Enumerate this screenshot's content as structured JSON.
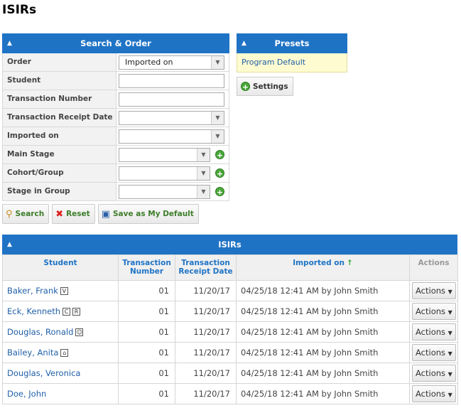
{
  "page_title": "ISIRs",
  "search_panel": {
    "title": "Search & Order",
    "rows": [
      {
        "label": "Order",
        "value": "Imported on"
      },
      {
        "label": "Student"
      },
      {
        "label": "Transaction Number"
      },
      {
        "label": "Transaction Receipt Date"
      },
      {
        "label": "Imported on"
      },
      {
        "label": "Main Stage"
      },
      {
        "label": "Cohort/Group"
      },
      {
        "label": "Stage in Group"
      }
    ],
    "buttons": {
      "search": "Search",
      "reset": "Reset",
      "save_default": "Save as My Default"
    }
  },
  "presets": {
    "title": "Presets",
    "item": "Program Default",
    "settings": "Settings"
  },
  "isirs": {
    "title": "ISIRs",
    "columns": {
      "student": "Student",
      "transaction_number": "Transaction Number",
      "receipt_date": "Transaction Receipt Date",
      "imported_on": "Imported on",
      "actions": "Actions"
    },
    "rows": [
      {
        "student": "Baker, Frank",
        "badges": [
          "V"
        ],
        "txn": "01",
        "date": "11/20/17",
        "imported": "04/25/18 12:41 AM by John Smith",
        "action": "Actions"
      },
      {
        "student": "Eck, Kenneth",
        "badges": [
          "C",
          "R"
        ],
        "txn": "01",
        "date": "11/20/17",
        "imported": "04/25/18 12:41 AM by John Smith",
        "action": "Actions"
      },
      {
        "student": "Douglas, Ronald",
        "badges": [
          "☺"
        ],
        "txn": "01",
        "date": "11/20/17",
        "imported": "04/25/18 12:41 AM by John Smith",
        "action": "Actions"
      },
      {
        "student": "Bailey, Anita",
        "badges": [
          "⌂"
        ],
        "txn": "01",
        "date": "11/20/17",
        "imported": "04/25/18 12:41 AM by John Smith",
        "action": "Actions"
      },
      {
        "student": "Douglas, Veronica",
        "badges": [],
        "txn": "01",
        "date": "11/20/17",
        "imported": "04/25/18 12:41 AM by John Smith",
        "action": "Actions"
      },
      {
        "student": "Doe, John",
        "badges": [],
        "txn": "01",
        "date": "11/20/17",
        "imported": "04/25/18 12:41 AM by John Smith",
        "action": "Actions"
      }
    ]
  }
}
